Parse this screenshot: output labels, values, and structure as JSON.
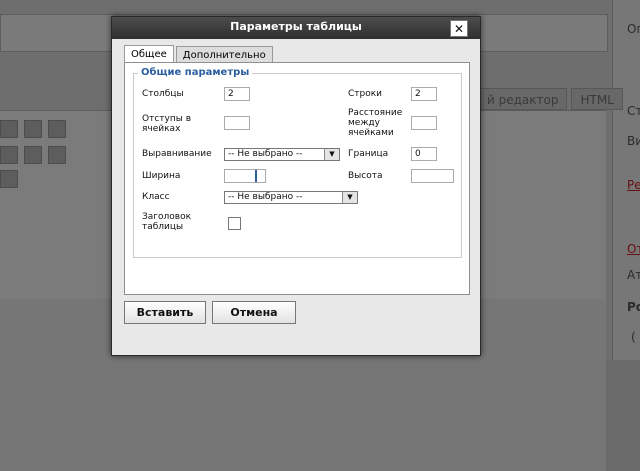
{
  "background": {
    "right_texts": [
      "Оп",
      "Ста",
      "Ви",
      "Ред",
      "От",
      "Ат",
      "Род",
      "("
    ],
    "tabs": [
      "й редактор",
      "HTML"
    ]
  },
  "dialog": {
    "title": "Параметры таблицы",
    "close_label": "✕",
    "tabs": [
      "Общее",
      "Дополнительно"
    ],
    "legend": "Общие параметры",
    "fields": {
      "columns_label": "Столбцы",
      "columns_value": "2",
      "rows_label": "Строки",
      "rows_value": "2",
      "padding_label": "Отступы в ячейках",
      "spacing_label": "Расстояние между ячейками",
      "align_label": "Выравнивание",
      "align_value": "-- Не выбрано --",
      "border_label": "Граница",
      "border_value": "0",
      "width_label": "Ширина",
      "height_label": "Высота",
      "class_label": "Класс",
      "class_value": "-- Не выбрано --",
      "header_label": "Заголовок таблицы"
    },
    "buttons": {
      "insert": "Вставить",
      "cancel": "Отмена"
    }
  },
  "colors": {
    "legend": "#2b5ea0",
    "titlebar": "#3a3a3a"
  }
}
